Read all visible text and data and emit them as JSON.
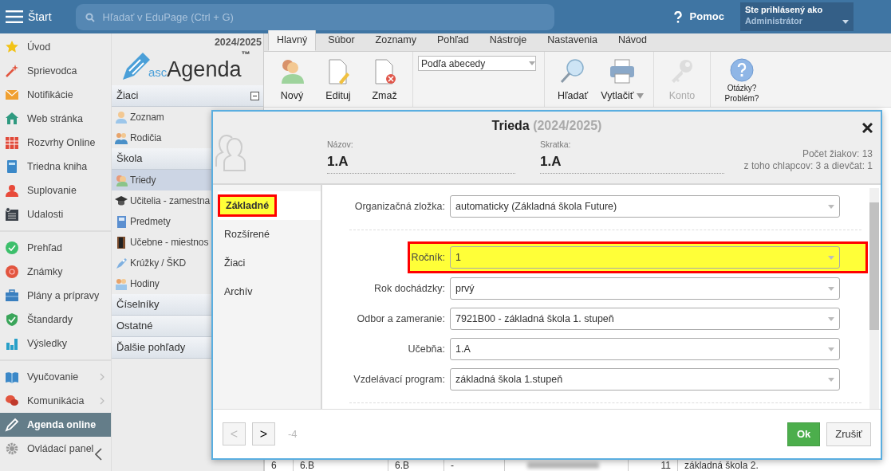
{
  "top_bar": {
    "menu_label": "Štart",
    "search": {
      "placeholder": "Hľadať v EduPage (Ctrl + G)"
    },
    "help": "Pomoc",
    "user": {
      "caption": "Ste prihlásený ako",
      "name": "Administrátor"
    }
  },
  "nav": {
    "groups": [
      {
        "items": [
          {
            "label": "Úvod",
            "selected": false,
            "submenu": false
          },
          {
            "label": "Sprievodca",
            "selected": false,
            "submenu": false
          },
          {
            "label": "Notifikácie",
            "selected": false,
            "submenu": false
          },
          {
            "label": "Web stránka",
            "selected": false,
            "submenu": false
          },
          {
            "label": "Rozvrhy Online",
            "selected": false,
            "submenu": false
          },
          {
            "label": "Triedna kniha",
            "selected": false,
            "submenu": false
          },
          {
            "label": "Suplovanie",
            "selected": false,
            "submenu": false
          },
          {
            "label": "Udalosti",
            "selected": false,
            "submenu": false
          }
        ]
      },
      {
        "items": [
          {
            "label": "Prehľad",
            "selected": false,
            "submenu": false
          },
          {
            "label": "Známky",
            "selected": false,
            "submenu": false
          },
          {
            "label": "Plány a prípravy",
            "selected": false,
            "submenu": false
          },
          {
            "label": "Štandardy",
            "selected": false,
            "submenu": false
          },
          {
            "label": "Výsledky",
            "selected": false,
            "submenu": false
          }
        ]
      },
      {
        "items": [
          {
            "label": "Vyučovanie",
            "selected": false,
            "submenu": true
          },
          {
            "label": "Komunikácia",
            "selected": false,
            "submenu": true
          },
          {
            "label": "Agenda online",
            "selected": true,
            "submenu": false
          },
          {
            "label": "Ovládací panel",
            "selected": false,
            "submenu": false
          }
        ]
      }
    ]
  },
  "agenda_panel": {
    "year": "2024/2025",
    "logo": {
      "prefix": "asc",
      "name": "Agenda",
      "mark": "™"
    },
    "sections": [
      {
        "title": "Žiaci",
        "collapse_button": true,
        "items": [
          {
            "label": "Zoznam",
            "selected": false
          },
          {
            "label": "Rodičia",
            "selected": false
          }
        ]
      },
      {
        "title": "Škola",
        "collapse_button": false,
        "items": [
          {
            "label": "Triedy",
            "selected": true
          },
          {
            "label": "Učitelia - zamestna",
            "selected": false
          },
          {
            "label": "Predmety",
            "selected": false
          },
          {
            "label": "Učebne - miestnos",
            "selected": false
          },
          {
            "label": "Krúžky / ŠKD",
            "selected": false
          },
          {
            "label": "Hodiny",
            "selected": false
          }
        ]
      },
      {
        "title": "Číselníky",
        "collapse_button": false
      },
      {
        "title": "Ostatné",
        "collapse_button": false
      },
      {
        "title": "Ďalšie pohľady",
        "collapse_button": false
      }
    ]
  },
  "ribbon": {
    "tabs": [
      {
        "label": "Hlavný",
        "selected": true
      },
      {
        "label": "Súbor",
        "selected": false
      },
      {
        "label": "Zoznamy",
        "selected": false
      },
      {
        "label": "Pohľad",
        "selected": false
      },
      {
        "label": "Nástroje",
        "selected": false
      },
      {
        "label": "Nastavenia",
        "selected": false
      },
      {
        "label": "Návod",
        "selected": false
      }
    ],
    "groups": [
      {
        "kind": "buttons",
        "items": [
          {
            "label": "Nový",
            "disabled": false,
            "has_menu": false
          },
          {
            "label": "Edituj",
            "disabled": false,
            "has_menu": false
          },
          {
            "label": "Zmaž",
            "disabled": false,
            "has_menu": false
          }
        ]
      },
      {
        "kind": "select",
        "value": "Podľa abecedy"
      },
      {
        "kind": "buttons",
        "items": [
          {
            "label": "Hľadať",
            "disabled": false,
            "has_menu": false
          },
          {
            "label": "Vytlačiť",
            "disabled": false,
            "has_menu": true
          }
        ]
      },
      {
        "kind": "buttons",
        "items": [
          {
            "label": "Konto",
            "disabled": true,
            "has_menu": false
          }
        ]
      },
      {
        "kind": "help",
        "lines": [
          "Otázky?",
          "Problém?"
        ]
      }
    ]
  },
  "dialog": {
    "title": "Trieda",
    "subtitle": "(2024/2025)",
    "fields": [
      {
        "label": "Názov:",
        "value": "1.A"
      },
      {
        "label": "Skratka:",
        "value": "1.A"
      }
    ],
    "stats": [
      "Počet žiakov: 13",
      "z toho chlapcov: 3 a dievčat: 1"
    ],
    "tabs": [
      {
        "label": "Základné",
        "selected": true,
        "highlighted": true
      },
      {
        "label": "Rozšírené",
        "selected": false,
        "highlighted": false
      },
      {
        "label": "Žiaci",
        "selected": false,
        "highlighted": false
      },
      {
        "label": "Archív",
        "selected": false,
        "highlighted": false
      }
    ],
    "form": [
      {
        "label": "Organizačná zložka:",
        "value": "automaticky (Základná škola Future)",
        "highlighted": false,
        "separator_after": true
      },
      {
        "label": "Ročník:",
        "value": "1",
        "highlighted": true,
        "separator_after": false
      },
      {
        "label": "Rok dochádzky:",
        "value": "prvý",
        "highlighted": false,
        "separator_after": false
      },
      {
        "label": "Odbor a zameranie:",
        "value": "7921B00 - základná škola 1. stupeň",
        "highlighted": false,
        "separator_after": false
      },
      {
        "label": "Učebňa:",
        "value": "1.A",
        "highlighted": false,
        "separator_after": false
      },
      {
        "label": "Vzdelávací program:",
        "value": "základná škola 1.stupeň",
        "highlighted": false,
        "separator_after": true
      }
    ],
    "footer": {
      "prev": {
        "label": "<",
        "disabled": true
      },
      "next": {
        "label": ">",
        "disabled": false
      },
      "counter": "-4",
      "ok": "Ok",
      "cancel": "Zrušiť"
    }
  },
  "background_row": {
    "cells": [
      "6",
      "6.B",
      "6.B",
      "-",
      "11",
      "základná škola 2."
    ]
  }
}
